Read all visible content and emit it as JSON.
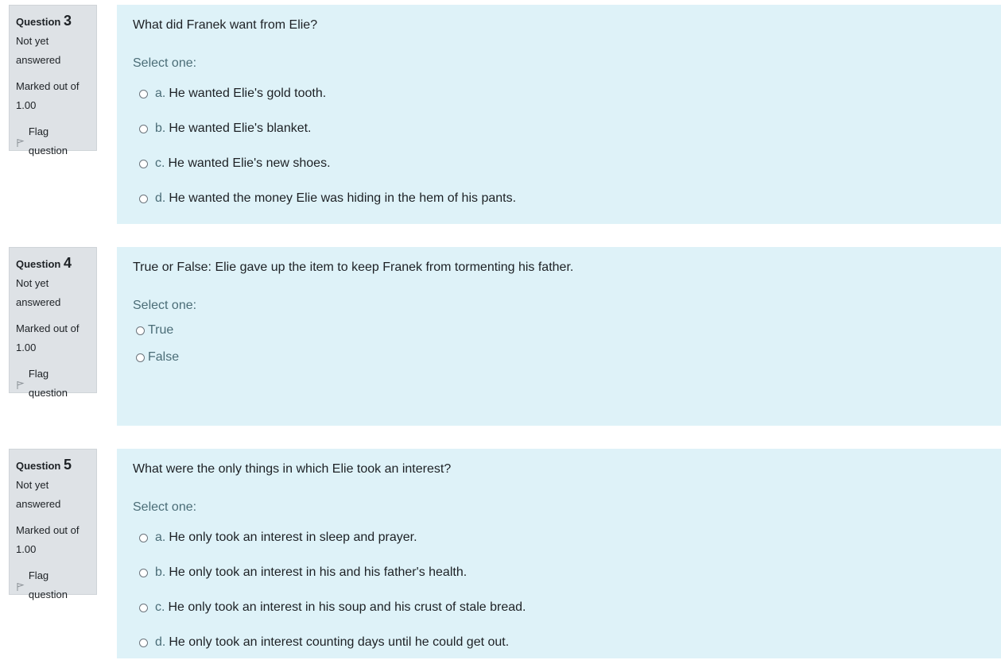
{
  "questions": [
    {
      "label": "Question",
      "number": "3",
      "state_line1": "Not yet",
      "state_line2": "answered",
      "grade_line1": "Marked out of",
      "grade_line2": "1.00",
      "flag_label": "Flag question",
      "text": "What did Franek want from Elie?",
      "prompt": "Select one:",
      "answers": [
        {
          "letter": "a.",
          "text": "He wanted Elie's gold tooth."
        },
        {
          "letter": "b.",
          "text": "He wanted Elie's blanket."
        },
        {
          "letter": "c.",
          "text": "He wanted Elie's new shoes."
        },
        {
          "letter": "d.",
          "text": "He wanted the money Elie was hiding in the hem of his pants."
        }
      ]
    },
    {
      "label": "Question",
      "number": "4",
      "state_line1": "Not yet",
      "state_line2": "answered",
      "grade_line1": "Marked out of",
      "grade_line2": "1.00",
      "flag_label": "Flag question",
      "text": "True or False: Elie gave up the item to keep Franek from tormenting his father.",
      "prompt": "Select one:",
      "answers": [
        {
          "text": "True"
        },
        {
          "text": "False"
        }
      ]
    },
    {
      "label": "Question",
      "number": "5",
      "state_line1": "Not yet",
      "state_line2": "answered",
      "grade_line1": "Marked out of",
      "grade_line2": "1.00",
      "flag_label": "Flag question",
      "text": "What were the only things in which Elie took an interest?",
      "prompt": "Select one:",
      "answers": [
        {
          "letter": "a.",
          "text": "He only took an interest in sleep and prayer."
        },
        {
          "letter": "b.",
          "text": "He only took an interest in his and his father's health."
        },
        {
          "letter": "c.",
          "text": "He only took an interest in his soup and his crust of stale bread."
        },
        {
          "letter": "d.",
          "text": "He only took an interest counting days until he could get out."
        }
      ]
    }
  ]
}
